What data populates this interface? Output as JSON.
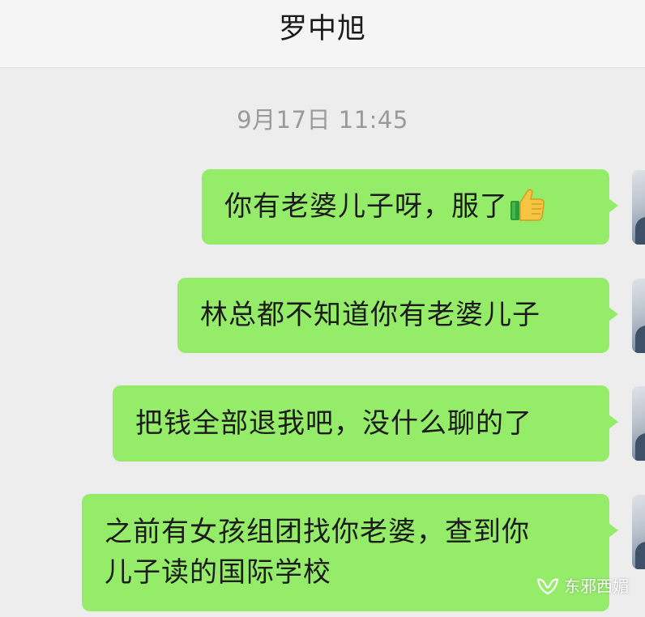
{
  "header": {
    "title": "罗中旭"
  },
  "timestamp": "9月17日 11:45",
  "messages": [
    {
      "lines": [
        "你有老婆儿子呀，服了"
      ],
      "emoji": "thumbs-up-icon"
    },
    {
      "lines": [
        "林总都不知道你有老婆儿子"
      ]
    },
    {
      "lines": [
        "把钱全部退我吧，没什么聊的了"
      ]
    },
    {
      "lines": [
        "之前有女孩组团找你老婆，查到你",
        "儿子读的国际学校"
      ]
    }
  ],
  "watermark": {
    "text": "东邪西媚",
    "icon": "wechat-channel-icon"
  },
  "colors": {
    "background": "#ededed",
    "header": "#f5f5f5",
    "bubble": "#95ec69",
    "timestamp": "#9a9a9a"
  }
}
